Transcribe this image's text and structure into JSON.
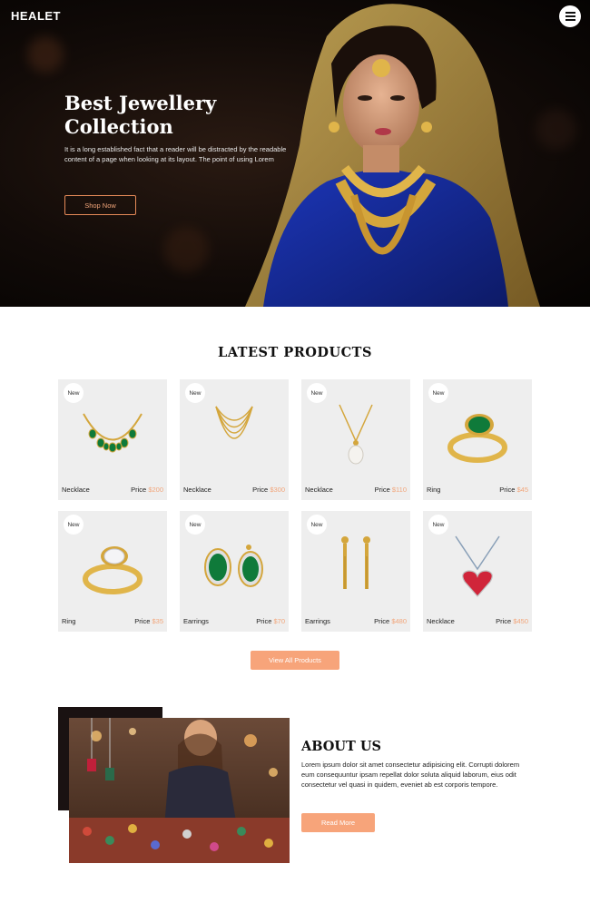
{
  "header": {
    "brand": "HEALET",
    "menu_icon": "menu-icon"
  },
  "hero": {
    "title": "Best Jewellery Collection",
    "text": "It is a long established fact that a reader will be distracted by the readable content of a page when looking at its layout. The point of using Lorem",
    "button": "Shop Now"
  },
  "products": {
    "title": "LATEST PRODUCTS",
    "price_label": "Price",
    "items": [
      {
        "badge": "New",
        "name": "Necklace",
        "price": "$200",
        "icon": "emerald-necklace-icon"
      },
      {
        "badge": "New",
        "name": "Necklace",
        "price": "$300",
        "icon": "gold-chain-necklace-icon"
      },
      {
        "badge": "New",
        "name": "Necklace",
        "price": "$110",
        "icon": "pearl-pendant-icon"
      },
      {
        "badge": "New",
        "name": "Ring",
        "price": "$45",
        "icon": "emerald-ring-icon"
      },
      {
        "badge": "New",
        "name": "Ring",
        "price": "$35",
        "icon": "diamond-ring-icon"
      },
      {
        "badge": "New",
        "name": "Earrings",
        "price": "$70",
        "icon": "emerald-earrings-icon"
      },
      {
        "badge": "New",
        "name": "Earrings",
        "price": "$480",
        "icon": "gold-drop-earrings-icon"
      },
      {
        "badge": "New",
        "name": "Necklace",
        "price": "$450",
        "icon": "heart-pendant-icon"
      }
    ],
    "view_all": "View All Products"
  },
  "about": {
    "title": "ABOUT US",
    "text": "Lorem ipsum dolor sit amet consectetur adipisicing elit. Corrupti dolorem eum consequuntur ipsam repellat dolor soluta aliquid laborum, eius odit consectetur vel quasi in quidem, eveniet ab est corporis tempore.",
    "button": "Read More"
  },
  "colors": {
    "accent": "#f7a47a",
    "hero_bg": "#120b08",
    "card_bg": "#eeeeee"
  }
}
